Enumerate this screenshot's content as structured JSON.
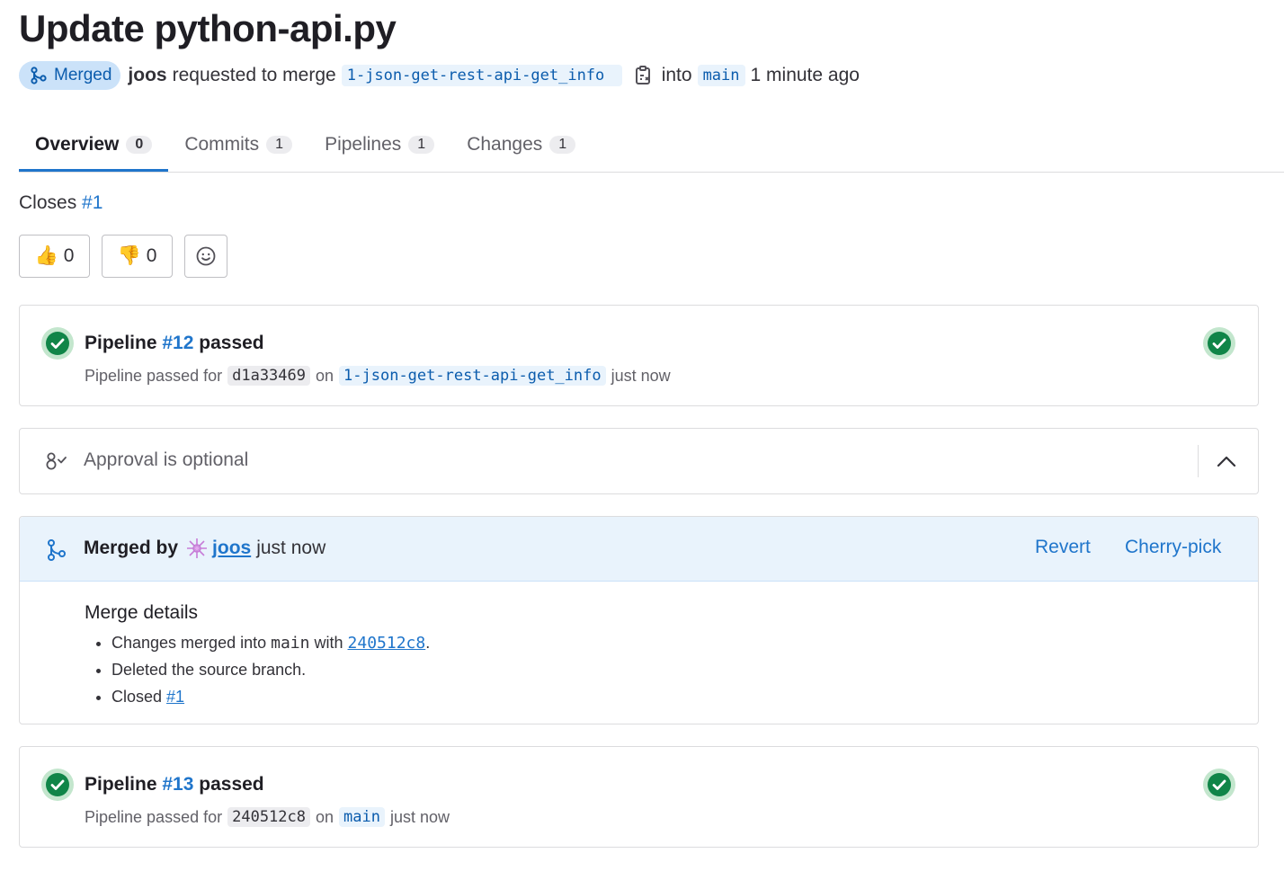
{
  "page": {
    "title": "Update python-api.py"
  },
  "meta": {
    "status_badge": "Merged",
    "author": "joos",
    "action_text": "requested to merge",
    "source_branch": "1-json-get-rest-api-get_info",
    "into_text": "into",
    "target_branch": "main",
    "time": "1 minute ago"
  },
  "tabs": [
    {
      "label": "Overview",
      "count": "0",
      "active": true
    },
    {
      "label": "Commits",
      "count": "1",
      "active": false
    },
    {
      "label": "Pipelines",
      "count": "1",
      "active": false
    },
    {
      "label": "Changes",
      "count": "1",
      "active": false
    }
  ],
  "closes": {
    "text": "Closes",
    "issue": "#1"
  },
  "reactions": {
    "thumbsup_emoji": "👍",
    "thumbsup_count": "0",
    "thumbsdown_emoji": "👎",
    "thumbsdown_count": "0",
    "add_reaction_icon": "smiley-icon"
  },
  "pipeline1": {
    "title_prefix": "Pipeline",
    "id": "#12",
    "title_suffix": "passed",
    "sub_prefix": "Pipeline passed for",
    "commit": "d1a33469",
    "on_text": "on",
    "branch": "1-json-get-rest-api-get_info",
    "time": "just now"
  },
  "approval": {
    "text": "Approval is optional"
  },
  "merged": {
    "by_label": "Merged by",
    "user": "joos",
    "time": "just now",
    "revert_label": "Revert",
    "cherry_pick_label": "Cherry-pick",
    "details_title": "Merge details",
    "item1_prefix": "Changes merged into",
    "item1_branch": "main",
    "item1_with": "with",
    "item1_commit": "240512c8",
    "item1_suffix": ".",
    "item2": "Deleted the source branch.",
    "item3_prefix": "Closed",
    "item3_issue": "#1"
  },
  "pipeline2": {
    "title_prefix": "Pipeline",
    "id": "#13",
    "title_suffix": "passed",
    "sub_prefix": "Pipeline passed for",
    "commit": "240512c8",
    "on_text": "on",
    "branch": "main",
    "time": "just now"
  },
  "colors": {
    "link": "#1f75cb",
    "success": "#108548",
    "merged_badge_bg": "#cbe2f9"
  }
}
